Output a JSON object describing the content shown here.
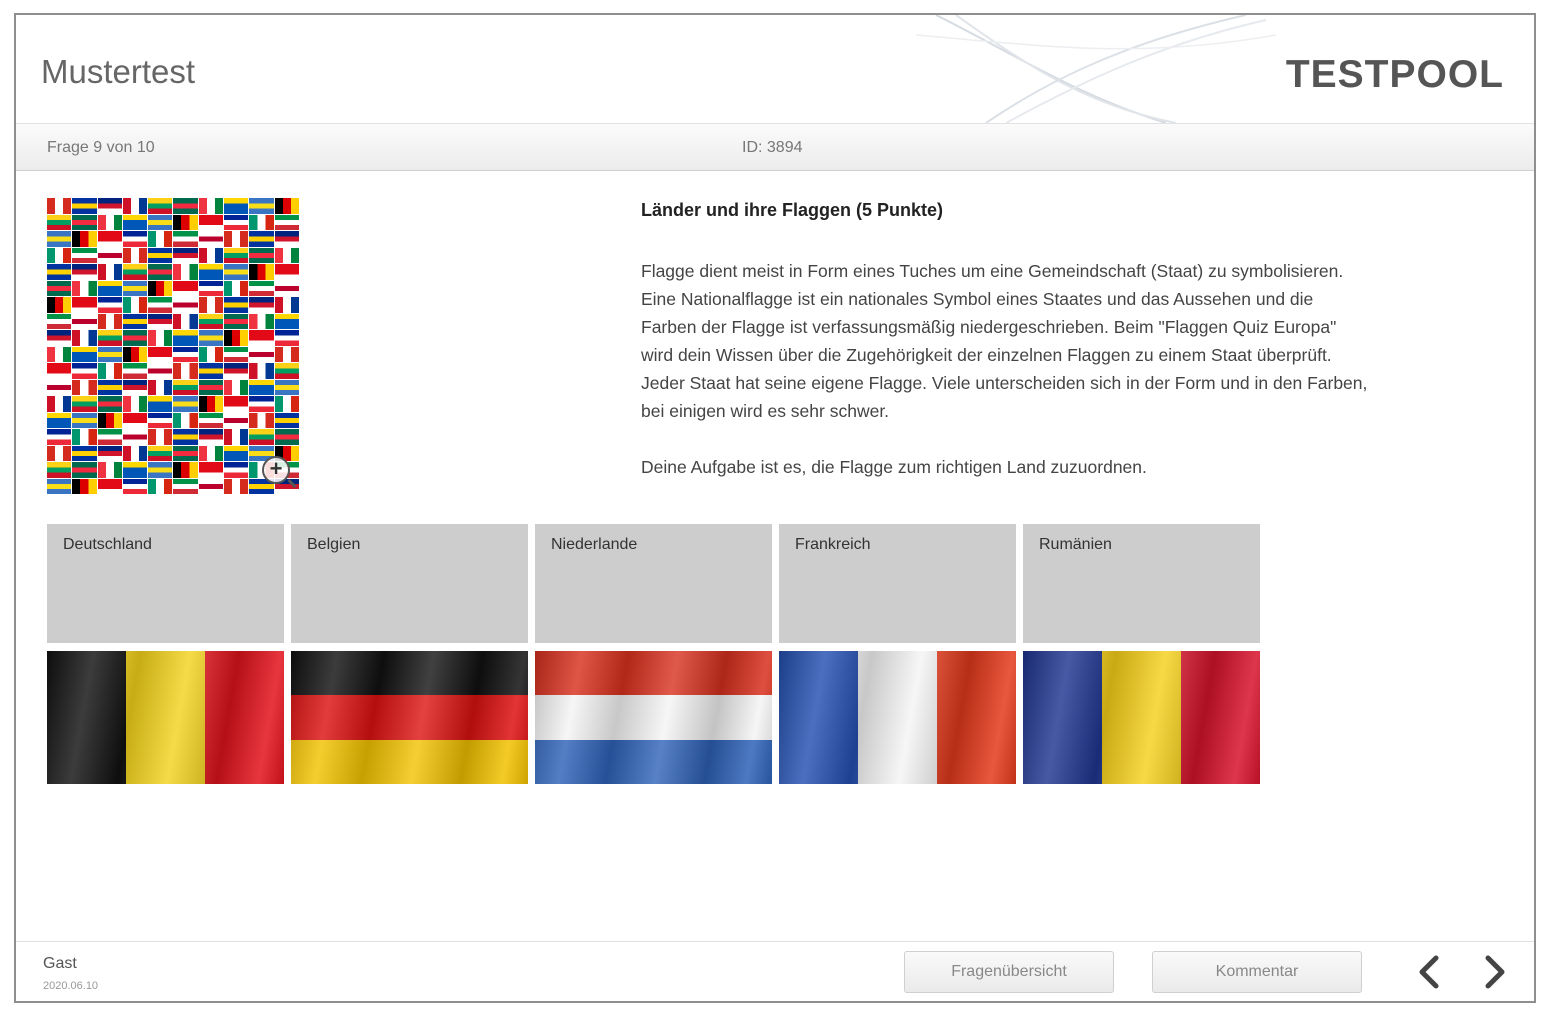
{
  "header": {
    "title": "Mustertest",
    "brand": "TESTPOOL"
  },
  "infobar": {
    "question_counter": "Frage 9 von 10",
    "id": "ID: 3894"
  },
  "question": {
    "heading": "Länder und ihre Flaggen (5 Punkte)",
    "body": [
      "Flagge dient meist in Form eines Tuches um eine Gemeindschaft (Staat) zu symbolisieren.",
      "Eine Nationalflagge ist ein nationales Symbol eines Staates und das Aussehen und die",
      "Farben der Flagge ist verfassungsmäßig niedergeschrieben. Beim \"Flaggen Quiz Europa\"",
      "wird dein Wissen über die Zugehörigkeit der einzelnen Flaggen zu einem Staat überprüft.",
      "Jeder Staat hat seine eigene Flagge. Viele unterscheiden sich in der Form und in den Farben,",
      "bei einigen wird es sehr schwer."
    ],
    "task": "Deine Aufgabe ist es, die Flagge zum richtigen Land zuzuordnen."
  },
  "targets": [
    "Deutschland",
    "Belgien",
    "Niederlande",
    "Frankreich",
    "Rumänien"
  ],
  "flags": [
    {
      "name": "belgium-flag",
      "orientation": "vertical",
      "colors": [
        "#111111",
        "#f3d21a",
        "#e3131c"
      ]
    },
    {
      "name": "germany-flag",
      "orientation": "horizontal",
      "colors": [
        "#111111",
        "#dd1111",
        "#f2c200"
      ]
    },
    {
      "name": "netherlands-flag",
      "orientation": "horizontal",
      "colors": [
        "#d8301e",
        "#f4f4f4",
        "#2e62b8"
      ]
    },
    {
      "name": "france-flag",
      "orientation": "vertical",
      "colors": [
        "#2450b0",
        "#f4f4f4",
        "#e43a1c"
      ]
    },
    {
      "name": "romania-flag",
      "orientation": "vertical",
      "colors": [
        "#1f3590",
        "#f5cf18",
        "#d8132c"
      ]
    }
  ],
  "footer": {
    "user": "Gast",
    "date": "2020.06.10",
    "overview_button": "Fragenübersicht",
    "comment_button": "Kommentar",
    "prev_icon": "chevron-left-icon",
    "next_icon": "chevron-right-icon"
  }
}
